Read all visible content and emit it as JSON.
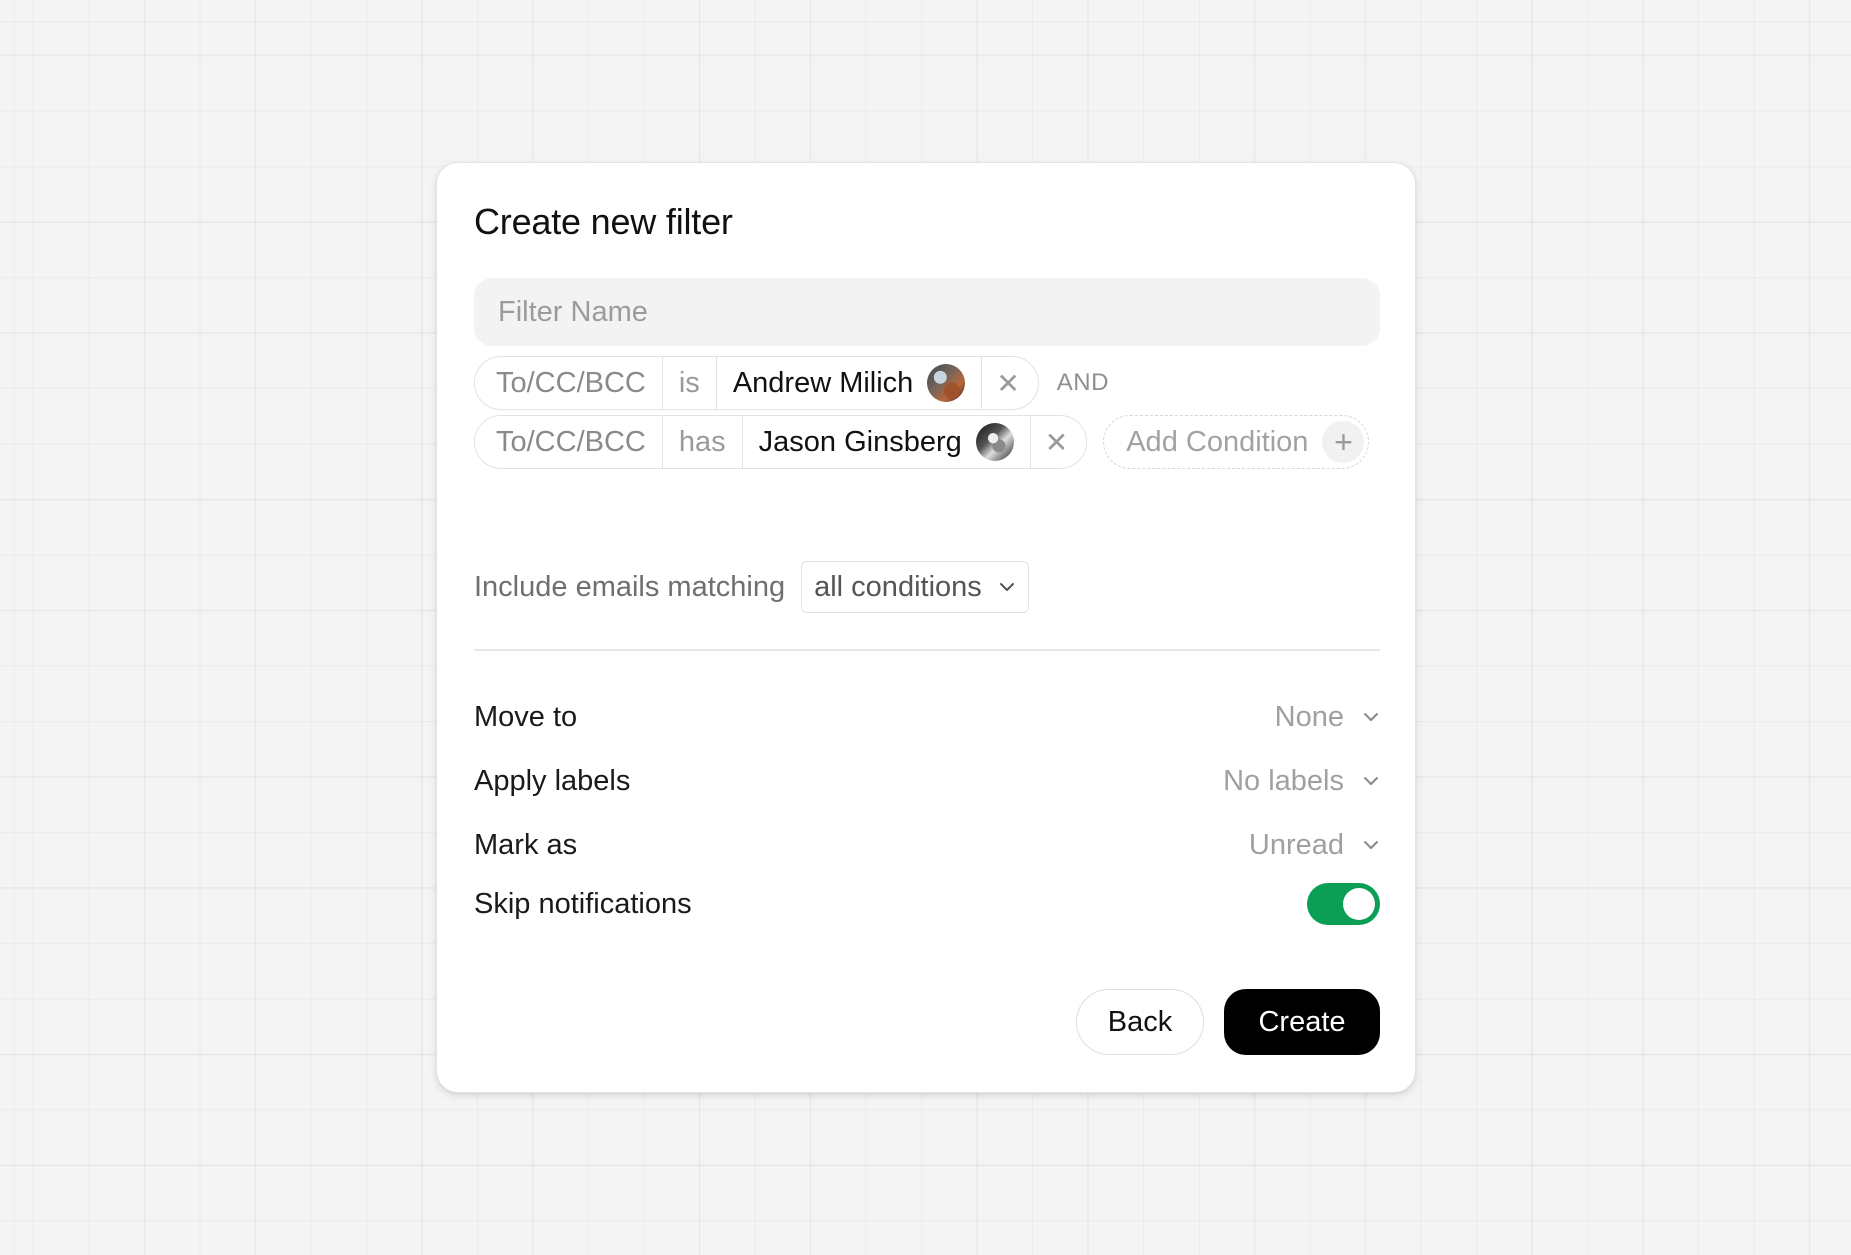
{
  "dialog": {
    "title": "Create new filter",
    "filter_name": {
      "placeholder": "Filter Name",
      "value": ""
    },
    "conditions": [
      {
        "field": "To/CC/BCC",
        "operator": "is",
        "value": "Andrew Milich",
        "avatar_icon": "avatar-photo-icon",
        "remove_icon": "close-icon"
      },
      {
        "field": "To/CC/BCC",
        "operator": "has",
        "value": "Jason Ginsberg",
        "avatar_icon": "avatar-photo-icon",
        "remove_icon": "close-icon"
      }
    ],
    "conjunction": "AND",
    "add_condition_label": "Add Condition",
    "match": {
      "label": "Include emails matching",
      "selected": "all conditions"
    },
    "options": [
      {
        "label": "Move to",
        "value": "None"
      },
      {
        "label": "Apply labels",
        "value": "No labels"
      },
      {
        "label": "Mark as",
        "value": "Unread"
      }
    ],
    "skip_notifications": {
      "label": "Skip notifications",
      "enabled": true,
      "color": "#0a9f55"
    },
    "buttons": {
      "back": "Back",
      "create": "Create"
    }
  }
}
